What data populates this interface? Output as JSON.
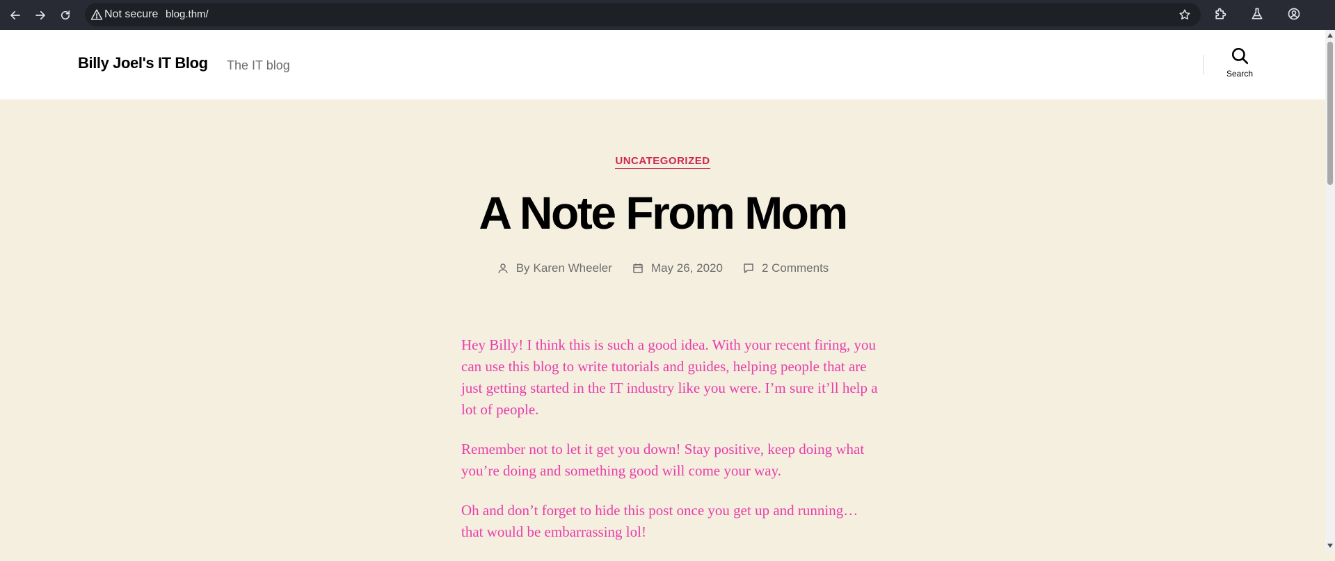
{
  "browser": {
    "security_label": "Not secure",
    "url": "blog.thm/",
    "icons": [
      "back-icon",
      "forward-icon",
      "reload-icon",
      "warning-icon",
      "star-icon",
      "extensions-icon",
      "labs-icon",
      "profile-icon"
    ]
  },
  "header": {
    "site_title": "Billy Joel's IT Blog",
    "site_description": "The IT blog",
    "search_label": "Search"
  },
  "post": {
    "category": "UNCATEGORIZED",
    "title": "A Note From Mom",
    "author_prefix": "By",
    "author": "Karen Wheeler",
    "date": "May 26, 2020",
    "comments": "2 Comments",
    "paragraphs": [
      "Hey Billy!  I think this is such a good idea.  With your recent firing, you can use this blog to write tutorials and guides, helping people that are just getting started in the IT industry like you were.  I’m sure it’ll help a lot of people.",
      "Remember not to let it get you down!  Stay positive, keep doing what you’re doing and something good will come your way.",
      "Oh and don’t forget to hide this post once you get up and running… that would be embarrassing lol!"
    ]
  },
  "colors": {
    "accent": "#cd2653",
    "content_text": "#e83ea8",
    "page_background": "#f5efe0",
    "chrome_background": "#282b33"
  }
}
